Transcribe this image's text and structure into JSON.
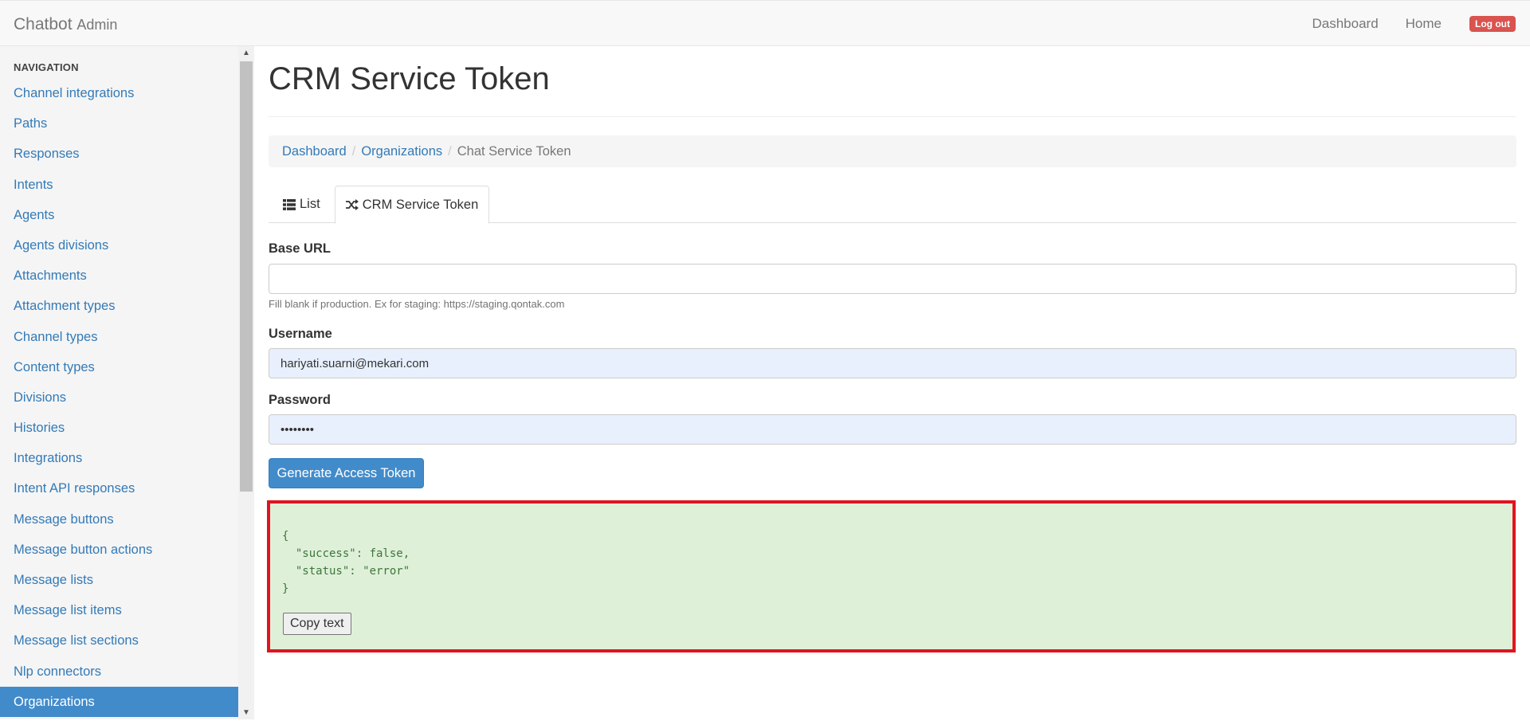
{
  "navbar": {
    "brand": "Chatbot",
    "brand_sub": "Admin",
    "links": [
      "Dashboard",
      "Home"
    ],
    "logout": "Log out"
  },
  "sidebar": {
    "header": "NAVIGATION",
    "items": [
      "Channel integrations",
      "Paths",
      "Responses",
      "Intents",
      "Agents",
      "Agents divisions",
      "Attachments",
      "Attachment types",
      "Channel types",
      "Content types",
      "Divisions",
      "Histories",
      "Integrations",
      "Intent API responses",
      "Message buttons",
      "Message button actions",
      "Message lists",
      "Message list items",
      "Message list sections",
      "Nlp connectors",
      "Organizations"
    ],
    "active_item": "Organizations"
  },
  "main": {
    "title": "CRM Service Token",
    "breadcrumb": [
      "Dashboard",
      "Organizations",
      "Chat Service Token"
    ],
    "tabs": {
      "list": "List",
      "crm": "CRM Service Token"
    },
    "form": {
      "base_url_label": "Base URL",
      "base_url_value": "",
      "base_url_help": "Fill blank if production. Ex for staging: https://staging.qontak.com",
      "username_label": "Username",
      "username_value": "hariyati.suarni@mekari.com",
      "password_label": "Password",
      "password_value": "••••••••",
      "generate_button": "Generate Access Token"
    },
    "result": {
      "json_text": "{\n  \"success\": false,\n  \"status\": \"error\"\n}",
      "copy_button": "Copy text"
    }
  },
  "colors": {
    "link": "#337ab7",
    "active_nav": "#428bca",
    "logout": "#d9534f",
    "result_bg": "#dff0d8",
    "result_highlight": "#e0141e"
  }
}
